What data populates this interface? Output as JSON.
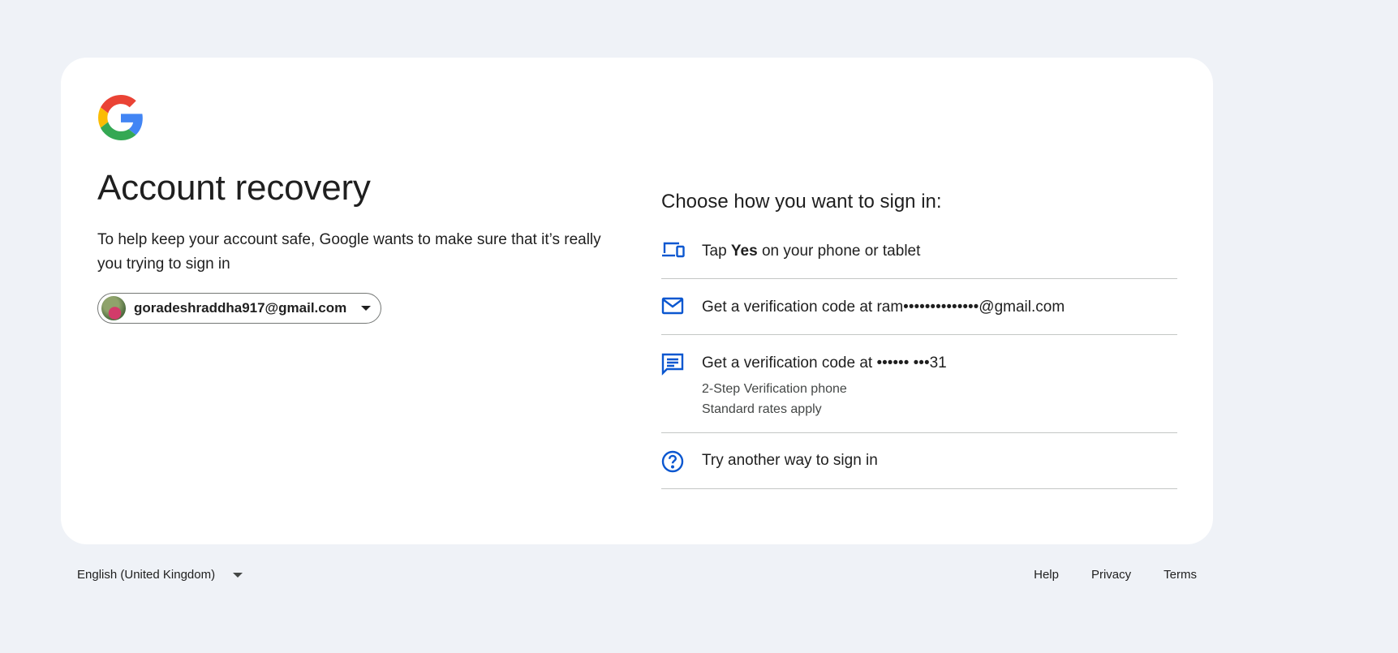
{
  "header": {
    "logo_icon": "google-g-logo",
    "title": "Account recovery",
    "subtitle": "To help keep your account safe, Google wants to make sure that it’s really you trying to sign in"
  },
  "account": {
    "email": "goradeshraddha917@gmail.com",
    "avatar_icon": "profile-photo",
    "caret_icon": "chevron-down-icon"
  },
  "signin": {
    "heading": "Choose how you want to sign in:",
    "options": [
      {
        "icon": "devices-icon",
        "prefix": "Tap ",
        "bold": "Yes",
        "suffix": " on your phone or tablet"
      },
      {
        "icon": "mail-icon",
        "text": "Get a verification code at ram••••••••••••••@gmail.com"
      },
      {
        "icon": "sms-icon",
        "text": "Get a verification code at •••••• •••31",
        "sub1": "2-Step Verification phone",
        "sub2": "Standard rates apply"
      },
      {
        "icon": "help-circle-icon",
        "text": "Try another way to sign in"
      }
    ]
  },
  "footer": {
    "language": "English (United Kingdom)",
    "links": [
      "Help",
      "Privacy",
      "Terms"
    ]
  },
  "colors": {
    "background": "#eff2f7",
    "card": "#ffffff",
    "accent_blue": "#0b57d0",
    "divider": "#c4c7c5",
    "text": "#1f1f1f"
  }
}
